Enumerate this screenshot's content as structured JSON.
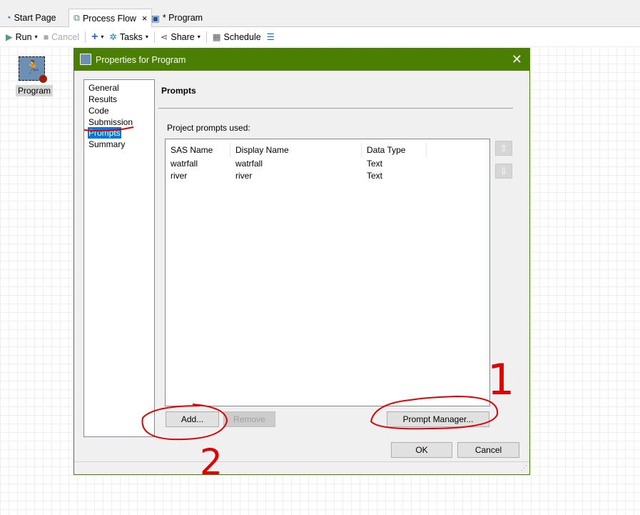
{
  "tabs": [
    {
      "label": "Start Page"
    },
    {
      "label": "Process Flow"
    },
    {
      "label": "* Program"
    }
  ],
  "toolbar": {
    "run": "Run",
    "cancel": "Cancel",
    "add": "+",
    "tasks": "Tasks",
    "share": "Share",
    "schedule": "Schedule"
  },
  "canvas": {
    "node_label": "Program"
  },
  "dialog": {
    "title": "Properties for Program",
    "nav": [
      "General",
      "Results",
      "Code Submission",
      "Prompts",
      "Summary"
    ],
    "selected_nav": "Prompts",
    "section_title": "Prompts",
    "prompts_label": "Project prompts used:",
    "columns": [
      "SAS Name",
      "Display Name",
      "Data Type"
    ],
    "rows": [
      [
        "watrfall",
        "watrfall",
        "Text"
      ],
      [
        "river",
        "river",
        "Text"
      ]
    ],
    "buttons": {
      "add": "Add...",
      "remove": "Remove",
      "prompt_manager": "Prompt Manager...",
      "ok": "OK",
      "cancel": "Cancel"
    }
  },
  "annotations": {
    "one": "1",
    "two": "2",
    "color": "#e00000"
  },
  "colors": {
    "titlebar": "#4b7f04",
    "selection": "#0078d7"
  }
}
